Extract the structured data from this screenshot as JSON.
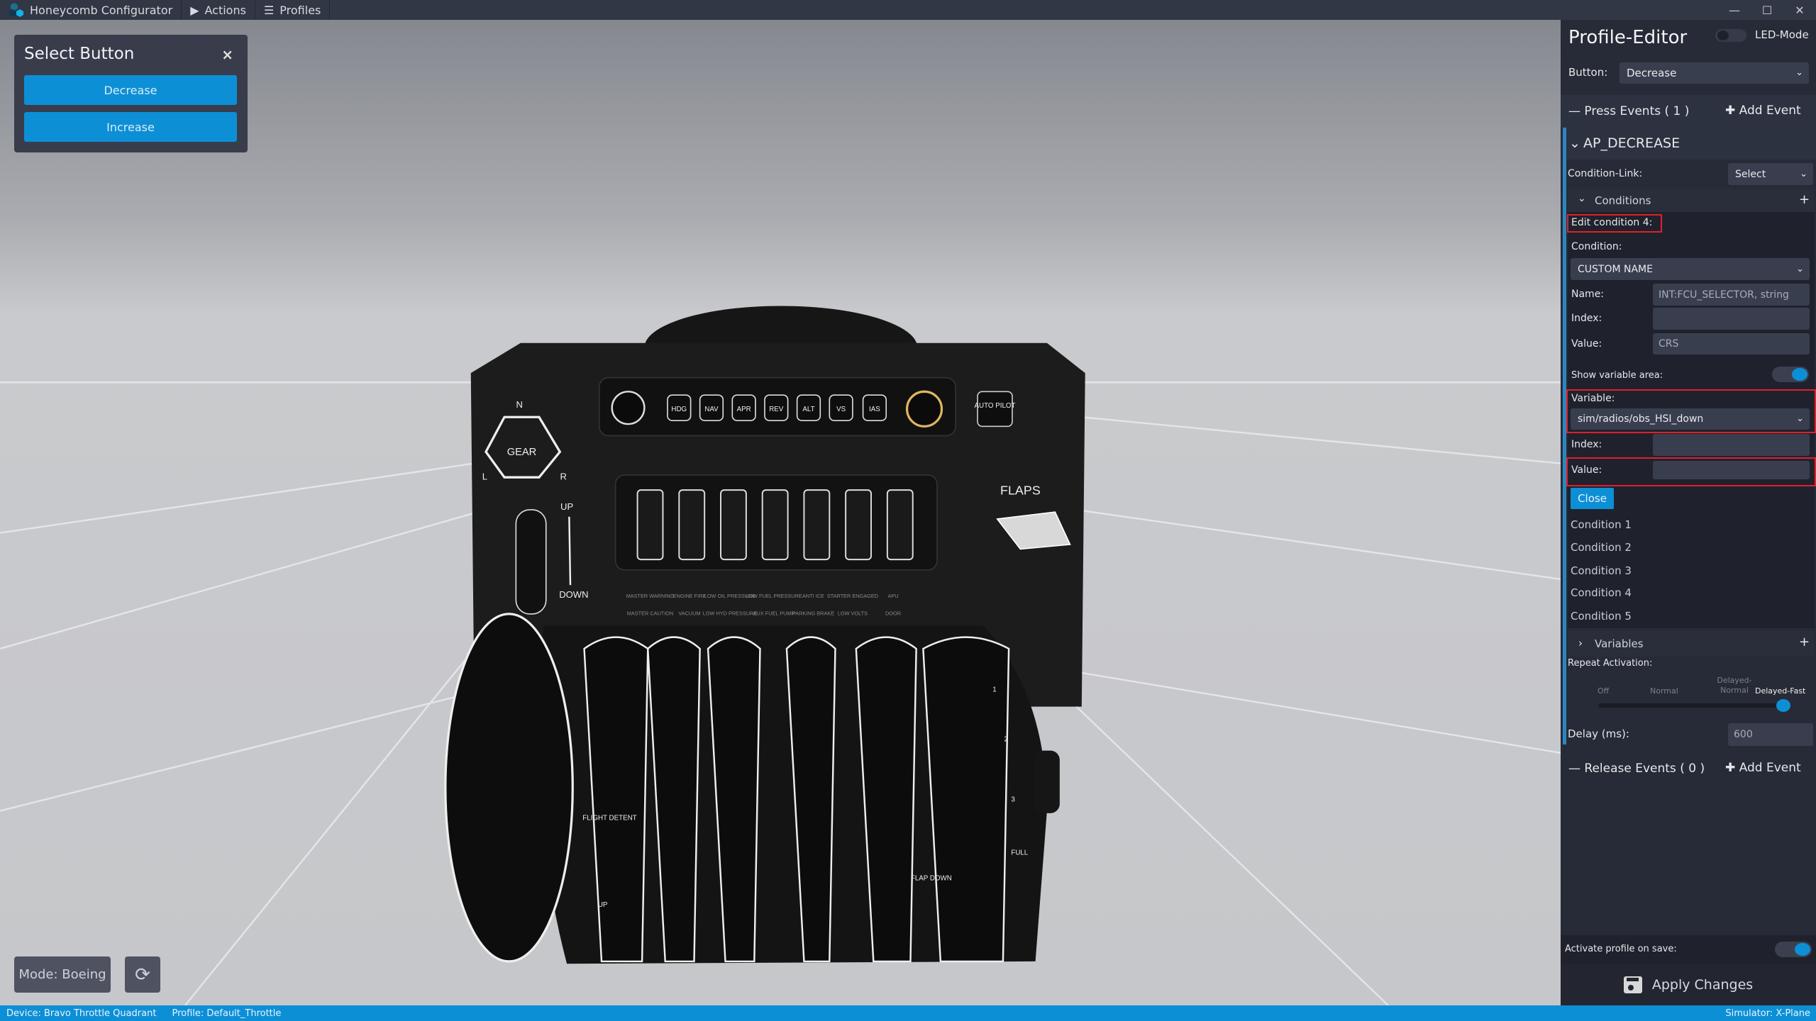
{
  "titlebar": {
    "app_name": "Honeycomb Configurator",
    "menu": [
      {
        "label": "Actions",
        "icon": "play-icon"
      },
      {
        "label": "Profiles",
        "icon": "list-icon"
      }
    ],
    "controls": {
      "minimize": "—",
      "maximize": "☐",
      "close": "✕"
    }
  },
  "select_button": {
    "title": "Select Button",
    "close": "×",
    "buttons": [
      "Decrease",
      "Increase"
    ]
  },
  "viewport": {
    "mode_label": "Mode: Boeing",
    "refresh_icon": "⟳",
    "device": {
      "ap_buttons": [
        "HDG",
        "NAV",
        "APR",
        "REV",
        "ALT",
        "VS",
        "IAS"
      ],
      "autopilot": "AUTO PILOT",
      "gear": "GEAR",
      "gear_marks": [
        "N",
        "L",
        "R"
      ],
      "gear_lever": [
        "UP",
        "DOWN"
      ],
      "flaps": "FLAPS",
      "annunciators_top": [
        "MASTER WARNING",
        "ENGINE FIRE",
        "LOW OIL PRESSURE",
        "LOW FUEL PRESSURE",
        "ANTI ICE",
        "STARTER ENGAGED",
        "APU"
      ],
      "annunciators_bottom": [
        "MASTER CAUTION",
        "VACUUM",
        "LOW HYD PRESSURE",
        "AUX FUEL PUMP",
        "PARKING BRAKE",
        "LOW VOLTS",
        "DOOR"
      ],
      "lever_labels": {
        "flight_detent": "FLIGHT DETENT",
        "flap_down": "FLAP DOWN",
        "up": "UP",
        "flap_positions": [
          "1",
          "2",
          "3",
          "FULL"
        ]
      }
    }
  },
  "profile_editor": {
    "title": "Profile-Editor",
    "led_mode": "LED-Mode",
    "led_mode_on": false,
    "button_label": "Button:",
    "button_value": "Decrease",
    "press_events": "Press Events ( 1 )",
    "add_event": "Add Event",
    "event_name": "AP_DECREASE",
    "condition_link_label": "Condition-Link:",
    "condition_link_value": "Select",
    "conditions_header": "Conditions",
    "edit_condition": "Edit condition 4:",
    "condition_label": "Condition:",
    "condition_value": "CUSTOM NAME",
    "name_label": "Name:",
    "name_value": "INT:FCU_SELECTOR, string",
    "index_label": "Index:",
    "index_value": "",
    "value_label": "Value:",
    "value_value": "CRS",
    "show_variable_label": "Show variable area:",
    "show_variable_on": true,
    "variable_label": "Variable:",
    "variable_value": "sim/radios/obs_HSI_down",
    "var_index_label": "Index:",
    "var_index_value": "",
    "var_value_label": "Value:",
    "var_value_value": "",
    "close_button": "Close",
    "conditions": [
      "Condition 1",
      "Condition 2",
      "Condition 3",
      "Condition 4",
      "Condition 5"
    ],
    "variables_header": "Variables",
    "repeat_label": "Repeat Activation:",
    "repeat_options": [
      "Off",
      "Normal",
      "Delayed-Normal",
      "Delayed-Fast"
    ],
    "repeat_selected": "Delayed-Fast",
    "delay_label": "Delay (ms):",
    "delay_value": "600",
    "release_events": "Release Events ( 0 )",
    "release_add_event": "Add Event",
    "activate_label": "Activate profile on save:",
    "activate_on": true,
    "apply_label": "Apply Changes"
  },
  "statusbar": {
    "device": "Device: Bravo Throttle Quadrant",
    "profile": "Profile: Default_Throttle",
    "simulator": "Simulator: X-Plane"
  },
  "colors": {
    "accent": "#0d8fd6",
    "panel": "#272b37",
    "highlight": "#e0202a"
  }
}
